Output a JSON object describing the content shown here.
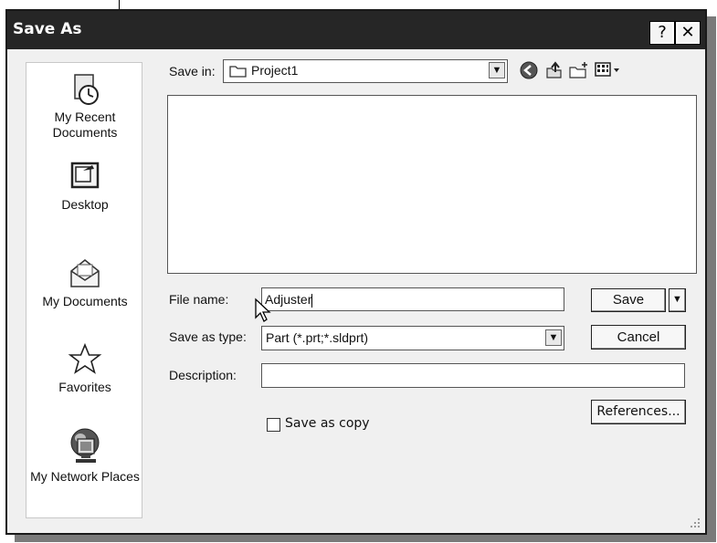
{
  "window": {
    "title": "Save As"
  },
  "title_buttons": {
    "help": "?",
    "close": "✕"
  },
  "places": [
    {
      "label": "My Recent Documents",
      "icon": "recent-documents-icon"
    },
    {
      "label": "Desktop",
      "icon": "desktop-icon"
    },
    {
      "label": "My Documents",
      "icon": "my-documents-icon"
    },
    {
      "label": "Favorites",
      "icon": "favorites-star-icon"
    },
    {
      "label": "My Network Places",
      "icon": "network-places-icon"
    }
  ],
  "save_in": {
    "label": "Save in:",
    "value": "Project1"
  },
  "toolbar": {
    "back": "back-icon",
    "up": "up-folder-icon",
    "new_folder": "new-folder-icon",
    "views": "views-menu-icon"
  },
  "file_name": {
    "label": "File name:",
    "value": "Adjuster"
  },
  "save_as_type": {
    "label": "Save as type:",
    "value": "Part (*.prt;*.sldprt)"
  },
  "description": {
    "label": "Description:",
    "value": ""
  },
  "save_as_copy": {
    "label": "Save as copy",
    "checked": false
  },
  "buttons": {
    "save": "Save",
    "cancel": "Cancel",
    "references": "References..."
  },
  "colors": {
    "titlebar": "#262626",
    "dialog_bg": "#f0f0f0"
  }
}
